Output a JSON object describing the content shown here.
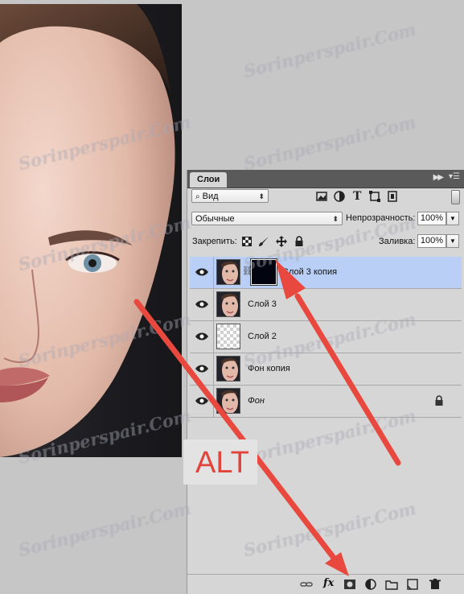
{
  "watermark": "Sorinperspair.Com",
  "panel": {
    "tab_label": "Слои",
    "filter": {
      "value": "Вид"
    },
    "blend_mode": {
      "value": "Обычные"
    },
    "opacity": {
      "label": "Непрозрачность:",
      "value": "100%"
    },
    "lock": {
      "label": "Закрепить:"
    },
    "fill": {
      "label": "Заливка:",
      "value": "100%"
    },
    "layers": [
      {
        "name": "Слой 3 копия",
        "selected": true,
        "has_mask": true,
        "thumb": "face"
      },
      {
        "name": "Слой 3",
        "selected": false,
        "has_mask": false,
        "thumb": "face"
      },
      {
        "name": "Слой 2",
        "selected": false,
        "has_mask": false,
        "thumb": "transparent"
      },
      {
        "name": "Фон копия",
        "selected": false,
        "has_mask": false,
        "thumb": "face"
      },
      {
        "name": "Фон",
        "selected": false,
        "has_mask": false,
        "thumb": "face",
        "locked": true,
        "italic": true
      }
    ],
    "bottom_icons": [
      "link-icon",
      "fx-icon",
      "add-mask-icon",
      "adjustment-icon",
      "folder-icon",
      "new-layer-icon",
      "trash-icon"
    ],
    "fx_label": "fx"
  },
  "callout": {
    "text": "ALT",
    "color": "#e0443a"
  },
  "colors": {
    "selected_row": "#b9cff5",
    "arrow": "#e8483e",
    "panel_bg": "#d6d6d6"
  }
}
